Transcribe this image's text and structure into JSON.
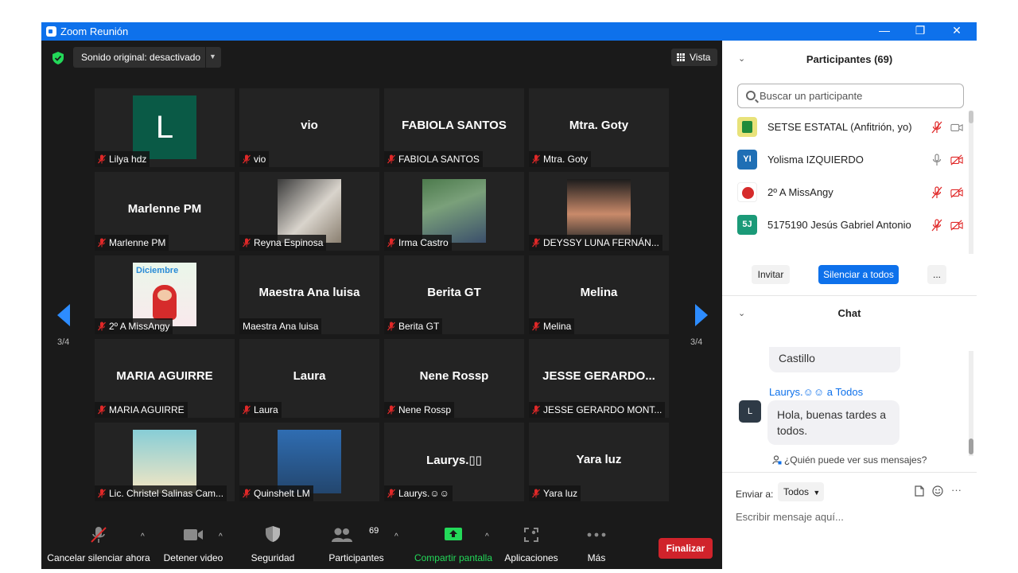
{
  "window": {
    "title": "Zoom Reunión",
    "minimize": "—",
    "restore": "❐",
    "close": "✕"
  },
  "topbar": {
    "sound_label": "Sonido original: desactivado",
    "sound_caret": "▼",
    "view_label": "Vista"
  },
  "page_indicator": "3/4",
  "tiles": [
    {
      "big": "",
      "name": "Lilya hdz",
      "avatar_letter": "L",
      "avatar_color": "#0a5a46",
      "muted": true
    },
    {
      "big": "vio",
      "name": "vio",
      "muted": true
    },
    {
      "big": "FABIOLA SANTOS",
      "name": "FABIOLA SANTOS",
      "muted": true
    },
    {
      "big": "Mtra. Goty",
      "name": "Mtra. Goty",
      "muted": true
    },
    {
      "big": "Marlenne PM",
      "name": "Marlenne PM",
      "muted": true
    },
    {
      "big": "",
      "name": "Reyna Espinosa",
      "muted": true
    },
    {
      "big": "",
      "name": "Irma Castro",
      "muted": true
    },
    {
      "big": "",
      "name": "DEYSSY LUNA FERNÁN...",
      "muted": true
    },
    {
      "big": "",
      "name": "2º A  MissAngy",
      "pic_label": "Diciembre",
      "muted": true
    },
    {
      "big": "Maestra Ana luisa",
      "name": "Maestra Ana luisa",
      "muted": false
    },
    {
      "big": "Berita GT",
      "name": "Berita GT",
      "muted": true
    },
    {
      "big": "Melina",
      "name": "Melina",
      "muted": true
    },
    {
      "big": "MARIA AGUIRRE",
      "name": "MARIA AGUIRRE",
      "muted": true
    },
    {
      "big": "Laura",
      "name": "Laura",
      "muted": true
    },
    {
      "big": "Nene Rossp",
      "name": "Nene Rossp",
      "muted": true
    },
    {
      "big": "JESSE  GERARDO...",
      "name": "JESSE GERARDO MONT...",
      "muted": true
    },
    {
      "big": "",
      "name": "Lic. Christel Salinas Cam...",
      "muted": true
    },
    {
      "big": "",
      "name": "Quinshelt LM",
      "muted": true
    },
    {
      "big": "Laurys.▯▯",
      "name": "Laurys.☺☺",
      "muted": true
    },
    {
      "big": "Yara luz",
      "name": "Yara luz",
      "muted": true
    }
  ],
  "toolbar": {
    "unmute": "Cancelar silenciar ahora",
    "video": "Detener video",
    "security": "Seguridad",
    "participants": "Participantes",
    "participants_count": "69",
    "share": "Compartir pantalla",
    "apps": "Aplicaciones",
    "more": "Más",
    "end": "Finalizar",
    "caret": "^"
  },
  "participants_panel": {
    "title": "Participantes (69)",
    "collapse": "⌄",
    "search_placeholder": "Buscar un participante",
    "rows": [
      {
        "initials": "",
        "name": "SETSE ESTATAL (Anfitrión, yo)",
        "color": "#e8e27a"
      },
      {
        "initials": "YI",
        "name": "Yolisma IZQUIERDO",
        "color": "#1f6fb5"
      },
      {
        "initials": "",
        "name": "2º A  MissAngy",
        "color": "#ffffff"
      },
      {
        "initials": "5J",
        "name": "5175190 Jesús Gabriel Antonio",
        "color": "#1b9a78"
      }
    ],
    "invite": "Invitar",
    "mute_all": "Silenciar a todos",
    "more": "..."
  },
  "chat": {
    "title": "Chat",
    "collapse": "⌄",
    "prev_bubble": "Castillo",
    "sender": "Laurys.☺☺ a Todos",
    "avatar": "L",
    "message": "Hola, buenas tardes a todos.",
    "who_can_see": "¿Quién puede ver sus mensajes?",
    "send_to_label": "Enviar a:",
    "send_to_value": "Todos",
    "compose_placeholder": "Escribir mensaje aquí...",
    "more": "···"
  },
  "colors": {
    "accent": "#0e71eb",
    "muted_red": "#e02828",
    "share_green": "#23d959",
    "end_red": "#d0232b"
  }
}
